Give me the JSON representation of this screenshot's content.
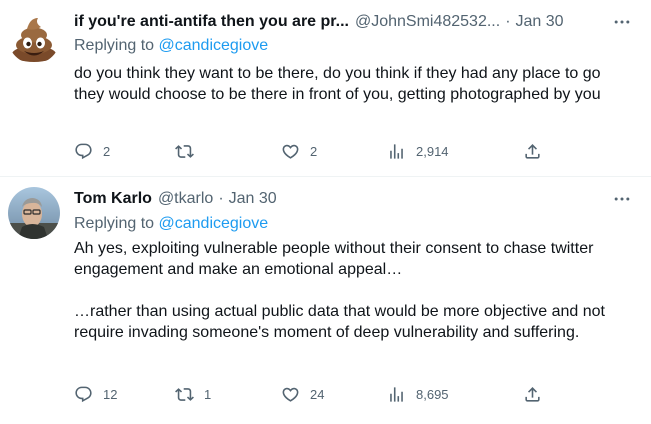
{
  "tweets": [
    {
      "avatar": "poop-emoji-avatar",
      "display_name": "if you're anti-antifa then you are pr...",
      "handle": "@JohnSmi482532...",
      "separator": "·",
      "date": "Jan 30",
      "replying_prefix": "Replying to",
      "replying_to": "@candicegiove",
      "paragraphs": [
        "do you think they want to be there, do you think if they had any place to go they would choose to be there in front of you, getting photographed by you"
      ],
      "replies": "2",
      "retweets": "",
      "likes": "2",
      "views": "2,914"
    },
    {
      "avatar": "photo-avatar",
      "display_name": "Tom Karlo",
      "handle": "@tkarlo",
      "separator": "·",
      "date": "Jan 30",
      "replying_prefix": "Replying to",
      "replying_to": "@candicegiove",
      "paragraphs": [
        "Ah yes, exploiting vulnerable people without their consent to chase twitter engagement and make an emotional appeal…",
        "…rather than using actual public data that would be more objective and not require invading someone's moment of deep vulnerability and suffering."
      ],
      "replies": "12",
      "retweets": "1",
      "likes": "24",
      "views": "8,695"
    }
  ],
  "colors": {
    "text": "#0f1419",
    "secondary": "#536471",
    "link": "#1d9bf0",
    "divider": "#eff3f4"
  },
  "icons": [
    "more-icon",
    "reply-icon",
    "retweet-icon",
    "like-icon",
    "views-icon",
    "share-icon"
  ]
}
